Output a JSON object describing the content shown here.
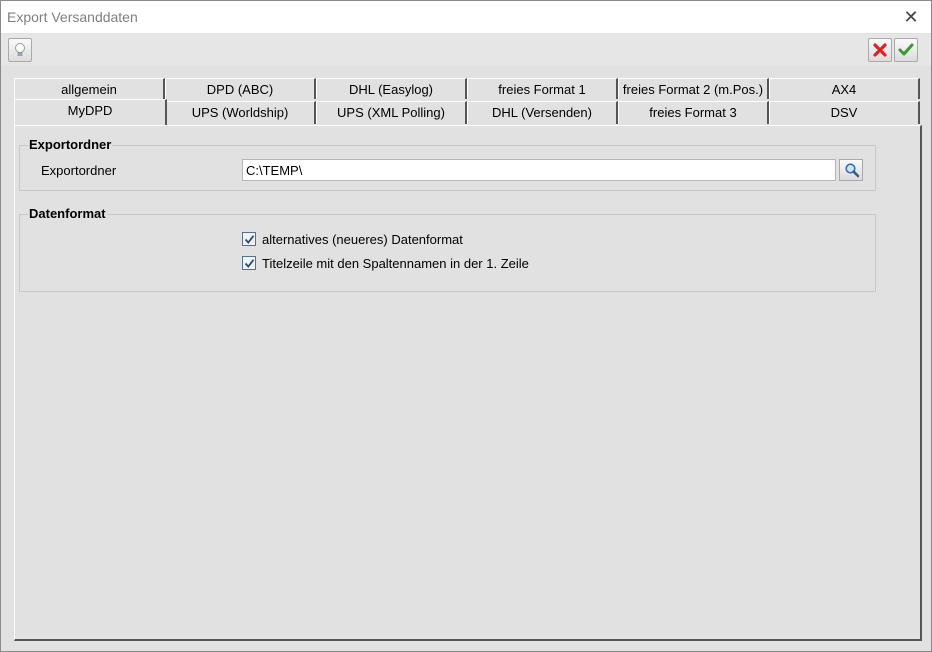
{
  "window": {
    "title": "Export Versanddaten"
  },
  "tabs_row1": [
    {
      "label": "allgemein"
    },
    {
      "label": "DPD (ABC)"
    },
    {
      "label": "DHL (Easylog)"
    },
    {
      "label": "freies Format 1"
    },
    {
      "label": "freies Format 2 (m.Pos.)"
    },
    {
      "label": "AX4"
    }
  ],
  "tabs_row2": [
    {
      "label": "MyDPD",
      "active": true
    },
    {
      "label": "UPS (Worldship)"
    },
    {
      "label": "UPS (XML Polling)"
    },
    {
      "label": "DHL (Versenden)"
    },
    {
      "label": "freies Format 3"
    },
    {
      "label": "DSV"
    }
  ],
  "export_group": {
    "title": "Exportordner",
    "field_label": "Exportordner",
    "field_value": "C:\\TEMP\\"
  },
  "format_group": {
    "title": "Datenformat",
    "checkboxes": [
      {
        "label": "alternatives (neueres) Datenformat",
        "checked": true
      },
      {
        "label": "Titelzeile mit den Spaltennamen in der 1. Zeile",
        "checked": true
      }
    ]
  },
  "icons": {
    "help": "lightbulb-icon",
    "cancel": "red-x-icon",
    "ok": "green-check-icon",
    "browse": "magnifier-icon",
    "close": "close-icon"
  }
}
